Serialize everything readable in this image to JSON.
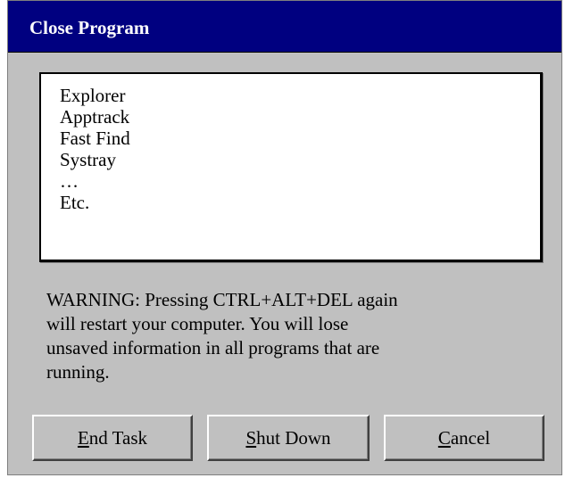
{
  "window": {
    "title": "Close Program"
  },
  "program_list": {
    "items": [
      "Explorer",
      "Apptrack",
      "Fast Find",
      "Systray",
      "…",
      "Etc."
    ]
  },
  "warning": {
    "lines": [
      "WARNING: Pressing CTRL+ALT+DEL again",
      "will restart your computer.  You will lose",
      "unsaved information in all programs that are",
      "running."
    ]
  },
  "buttons": {
    "end_task": {
      "mnemonic": "E",
      "rest": "nd Task"
    },
    "shut_down": {
      "mnemonic": "S",
      "rest": "hut Down"
    },
    "cancel": {
      "mnemonic": "C",
      "rest": "ancel"
    }
  },
  "colors": {
    "titlebar": "#000080",
    "dialog_face": "#c0c0c0",
    "list_background": "#ffffff"
  }
}
